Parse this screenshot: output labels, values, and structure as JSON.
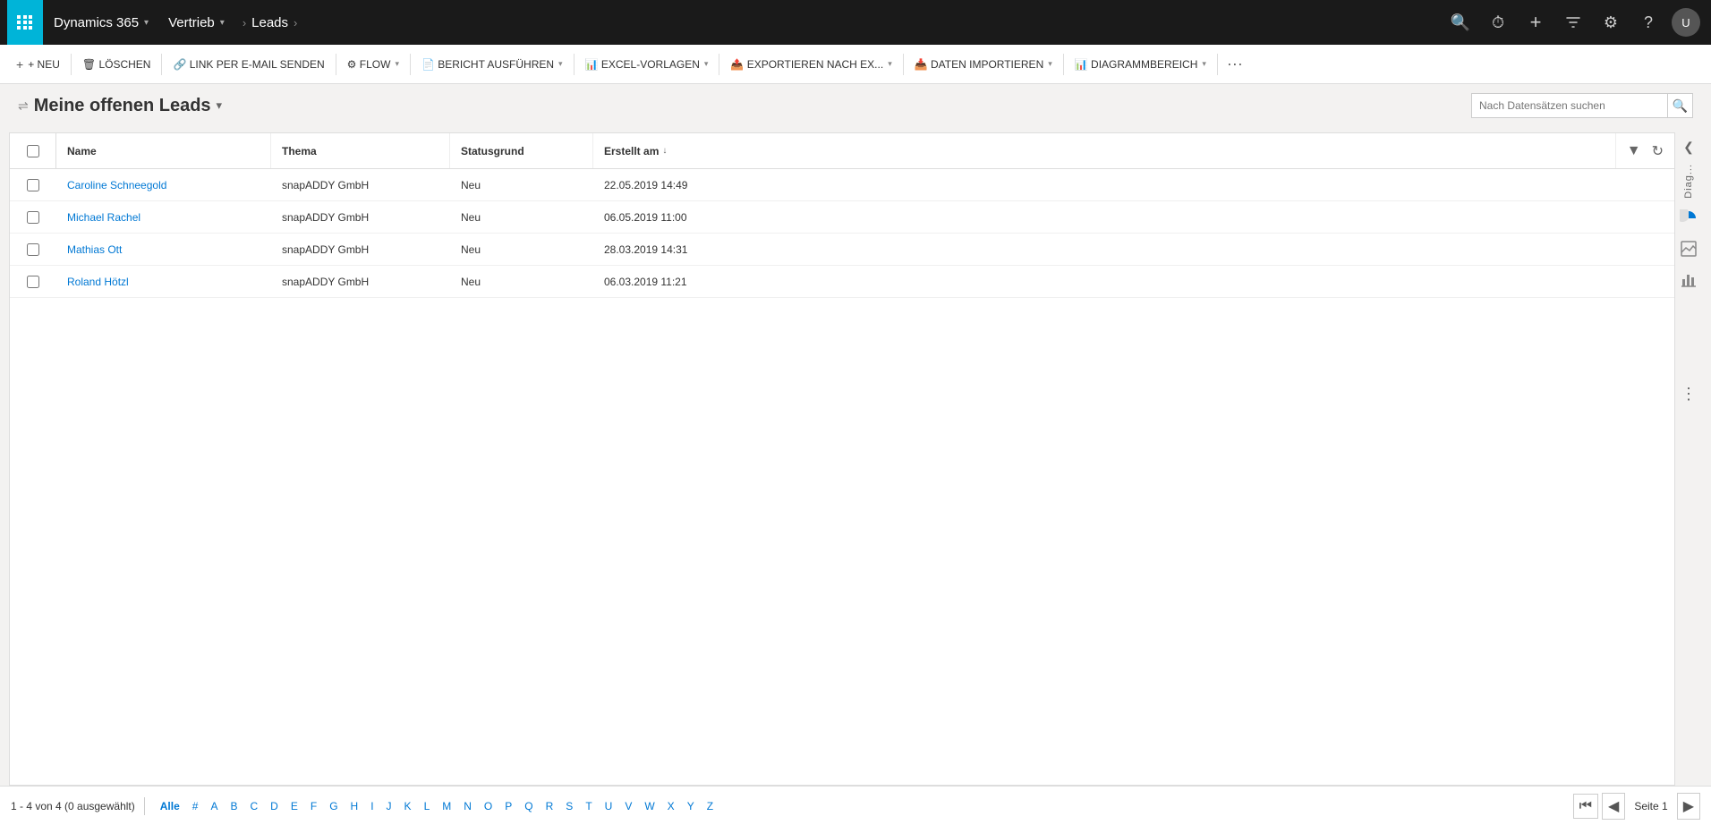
{
  "app": {
    "brand": "Dynamics 365",
    "brand_chevron": "▾",
    "module": "Vertrieb",
    "module_chevron": "▾",
    "breadcrumb": "Leads",
    "breadcrumb_arrow": "›"
  },
  "nav_icons": {
    "search": "🔍",
    "history": "⏱",
    "add": "+",
    "filter": "⚗",
    "settings": "⚙",
    "help": "?",
    "avatar_text": "U"
  },
  "toolbar": {
    "new_label": "+ NEU",
    "delete_label": "🗑 LÖSCHEN",
    "email_label": "🔗 LINK PER E-MAIL SENDEN",
    "flow_label": "⚙ FLOW",
    "report_label": "📄 BERICHT AUSFÜHREN",
    "excel_label": "📊 EXCEL-VORLAGEN",
    "export_label": "📤 EXPORTIEREN NACH EX...",
    "import_label": "📥 DATEN IMPORTIEREN",
    "diagram_label": "📊 DIAGRAMMBEREICH",
    "more_label": "···"
  },
  "view": {
    "pin_char": "⇌",
    "title": "Meine offenen Leads",
    "title_chevron": "▾",
    "search_placeholder": "Nach Datensätzen suchen",
    "search_icon": "🔍"
  },
  "table": {
    "columns": [
      {
        "key": "name",
        "label": "Name",
        "sortable": true,
        "sort_active": false
      },
      {
        "key": "thema",
        "label": "Thema",
        "sortable": false,
        "sort_active": false
      },
      {
        "key": "statusgrund",
        "label": "Statusgrund",
        "sortable": false,
        "sort_active": false
      },
      {
        "key": "erstellt",
        "label": "Erstellt am",
        "sortable": true,
        "sort_active": true
      }
    ],
    "rows": [
      {
        "name": "Caroline Schneegold",
        "thema": "snapADDY GmbH",
        "statusgrund": "Neu",
        "erstellt": "22.05.2019 14:49"
      },
      {
        "name": "Michael Rachel",
        "thema": "snapADDY GmbH",
        "statusgrund": "Neu",
        "erstellt": "06.05.2019 11:00"
      },
      {
        "name": "Mathias Ott",
        "thema": "snapADDY GmbH",
        "statusgrund": "Neu",
        "erstellt": "28.03.2019 14:31"
      },
      {
        "name": "Roland Hötzl",
        "thema": "snapADDY GmbH",
        "statusgrund": "Neu",
        "erstellt": "06.03.2019 11:21"
      }
    ],
    "filter_icon": "▼",
    "refresh_icon": "↻"
  },
  "right_sidebar": {
    "collapse_icon": "❮",
    "diag_label": "Diag...",
    "pie_icon": "◑",
    "chart_icon": "🖼",
    "bar_icon": "📊",
    "dots": "⋮"
  },
  "status_bar": {
    "count_text": "1 - 4 von 4 (0 ausgewählt)",
    "alpha_items": [
      "Alle",
      "#",
      "A",
      "B",
      "C",
      "D",
      "E",
      "F",
      "G",
      "H",
      "I",
      "J",
      "K",
      "L",
      "M",
      "N",
      "O",
      "P",
      "Q",
      "R",
      "S",
      "T",
      "U",
      "V",
      "W",
      "X",
      "Y",
      "Z"
    ],
    "nav_first": "⏮",
    "nav_prev": "◀",
    "page_label": "Seite 1",
    "nav_next": "▶"
  }
}
